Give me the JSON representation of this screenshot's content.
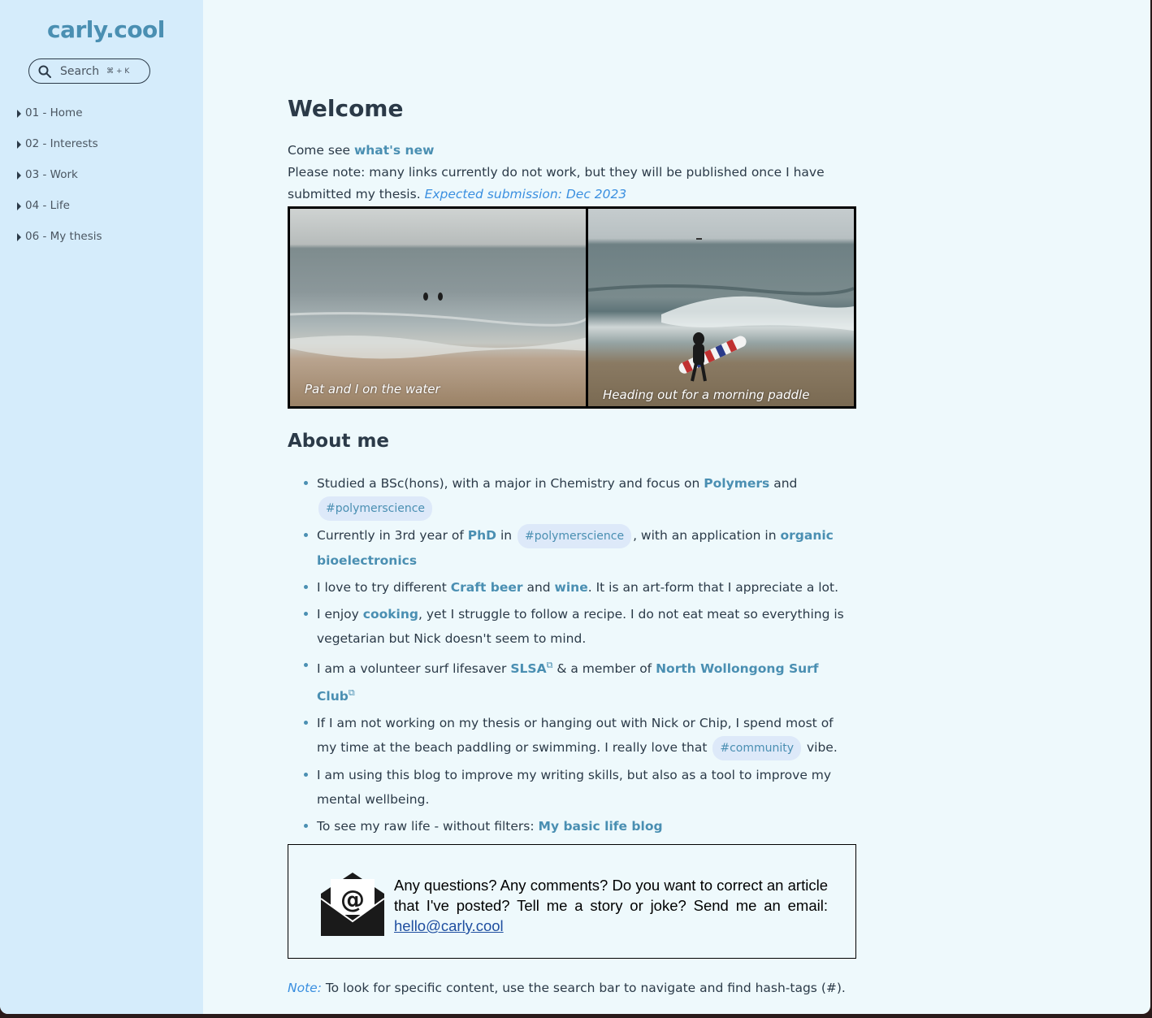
{
  "sidebar": {
    "site_title": "carly.cool",
    "search": {
      "label": "Search",
      "shortcut": "⌘ + K"
    },
    "items": [
      {
        "label": "01 - Home"
      },
      {
        "label": "02 - Interests"
      },
      {
        "label": "03 - Work"
      },
      {
        "label": "04 - Life"
      },
      {
        "label": "06 - My thesis"
      }
    ]
  },
  "main": {
    "title": "Welcome",
    "intro": {
      "come_see": "Come see ",
      "whats_new": "what's new",
      "note_text": "Please note: many links currently do not work, but they will be published once I have submitted my thesis. ",
      "expected": "Expected submission: Dec 2023"
    },
    "photos": [
      {
        "caption": "Pat and I on the water"
      },
      {
        "caption": "Heading out for a morning paddle"
      }
    ],
    "about_title": "About me",
    "about": {
      "item1": {
        "t1": "Studied a BSc(hons), with a major in Chemistry and focus on ",
        "link": "Polymers",
        "t2": " and ",
        "tag": "#polymerscience"
      },
      "item2": {
        "t1": "Currently in 3rd year of ",
        "link1": "PhD",
        "t2": " in ",
        "tag": "#polymerscience",
        "t3": ", with an application in ",
        "link2": "organic bioelectronics"
      },
      "item3": {
        "t1": "I love to try different ",
        "link1": "Craft beer",
        "t2": " and ",
        "link2": "wine",
        "t3": ". It is an art-form that I appreciate a lot."
      },
      "item4": {
        "t1": "I enjoy ",
        "link": "cooking",
        "t2": ", yet I struggle to follow a recipe. I do not eat meat so everything is vegetarian but Nick doesn't seem to mind."
      },
      "item5": {
        "t1": "I am a volunteer surf lifesaver ",
        "link1": "SLSA",
        "t2": " & a member of ",
        "link2": "North Wollongong Surf Club"
      },
      "item6": {
        "t1": "If I am not working on my thesis or hanging out with Nick or Chip, I spend most of my time at the beach paddling or swimming. I really love that ",
        "tag": "#community",
        "t2": " vibe."
      },
      "item7": {
        "t1": "I am using this blog to improve my writing skills, but also as a tool to improve my mental wellbeing."
      },
      "item8": {
        "t1": "To see my raw life - without filters: ",
        "link": "My basic life blog"
      }
    },
    "email": {
      "text": "Any questions? Any comments? Do you want to correct an article that I've posted? Tell me a story or joke? Send me an email: ",
      "address": "hello@carly.cool"
    },
    "note": {
      "label": "Note:",
      "text": " To look for specific content, use the search bar to navigate and find hash-tags (#)."
    }
  },
  "colors": {
    "accent": "#4a8fb2",
    "sidebar_bg": "#d5ecfb",
    "page_bg": "#eef9fc",
    "italic_link": "#3a8fe0"
  }
}
